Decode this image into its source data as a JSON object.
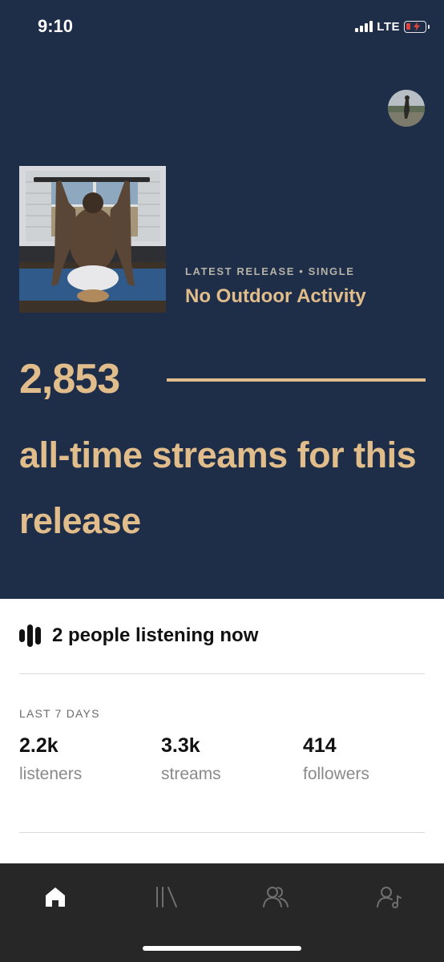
{
  "status_bar": {
    "time": "9:10",
    "network": "LTE",
    "battery": "low-charging-battery-icon",
    "signal": "full-signal-icon"
  },
  "header": {
    "avatar": "profile-avatar"
  },
  "latest_release": {
    "kicker": "LATEST RELEASE • SINGLE",
    "title": "No Outdoor Activity",
    "cover": "album-cover-image"
  },
  "streams": {
    "count": "2,853",
    "caption": "all-time streams for this release"
  },
  "listening": {
    "icon": "equalizer-bars-icon",
    "label": "2 people listening now"
  },
  "last_7_days": {
    "label": "LAST 7 DAYS",
    "stats": [
      {
        "value": "2.2k",
        "label": "listeners"
      },
      {
        "value": "3.3k",
        "label": "streams"
      },
      {
        "value": "414",
        "label": "followers"
      }
    ]
  },
  "tab_bar": {
    "tabs": [
      {
        "icon": "home-icon",
        "active": true
      },
      {
        "icon": "library-icon",
        "active": false
      },
      {
        "icon": "audience-icon",
        "active": false
      },
      {
        "icon": "profile-music-icon",
        "active": false
      }
    ]
  },
  "colors": {
    "hero_bg": "#1e2d48",
    "accent": "#e0bd8b",
    "tabbar_bg": "#272727"
  }
}
